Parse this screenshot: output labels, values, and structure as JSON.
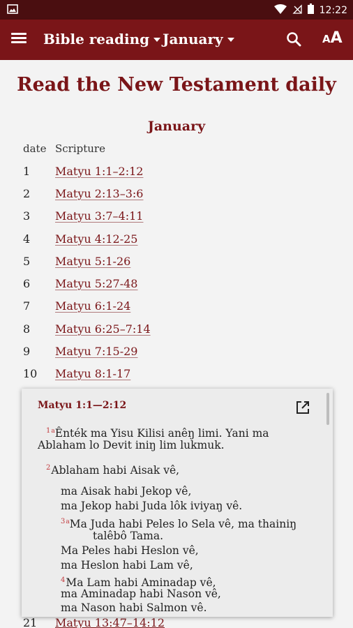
{
  "status_bar": {
    "time": "12:22"
  },
  "toolbar": {
    "reading_label": "Bible reading",
    "month_label": "January"
  },
  "page": {
    "title": "Read the New Testament daily",
    "month_heading": "January",
    "col_date": "date",
    "col_scripture": "Scripture"
  },
  "readings": [
    {
      "date": "1",
      "ref": "Matyu 1:1–2:12"
    },
    {
      "date": "2",
      "ref": "Matyu 2:13–3:6"
    },
    {
      "date": "3",
      "ref": "Matyu 3:7–4:11"
    },
    {
      "date": "4",
      "ref": "Matyu 4:12-25"
    },
    {
      "date": "5",
      "ref": "Matyu 5:1-26"
    },
    {
      "date": "6",
      "ref": "Matyu 5:27-48"
    },
    {
      "date": "7",
      "ref": "Matyu 6:1-24"
    },
    {
      "date": "8",
      "ref": "Matyu 6:25–7:14"
    },
    {
      "date": "9",
      "ref": "Matyu 7:15-29"
    },
    {
      "date": "10",
      "ref": "Matyu 8:1-17"
    }
  ],
  "peek_row": {
    "date": "21",
    "ref": "Matyu 13:47–14:12"
  },
  "popup": {
    "reference": "Matyu 1:1—2:12",
    "verses": [
      {
        "num": "1",
        "line1": "Ênték ma Yisu Kilisi anêŋ limi. Yani ma",
        "line2": "Ablaham lo Devit iniŋ lim lukmuk."
      },
      {
        "num": "2",
        "line1": "Ablaham habi Aisak vê,"
      },
      {
        "line1": "ma Aisak habi Jekop vê,"
      },
      {
        "line1": "ma Jekop habi Juda lôk iviyaŋ vê."
      },
      {
        "num": "3",
        "line1": "Ma Juda habi Peles lo Sela vê, ma thainiŋ",
        "line2": "talêbô Tama."
      },
      {
        "line1": "Ma Peles habi Heslon vê,"
      },
      {
        "line1": "ma Heslon habi Lam vê,"
      },
      {
        "num": "4",
        "line1": "Ma Lam habi Aminadap vê,"
      },
      {
        "line1": "ma Aminadap habi Nason vê,"
      },
      {
        "line1": "ma Nason habi Salmon vê."
      }
    ]
  }
}
